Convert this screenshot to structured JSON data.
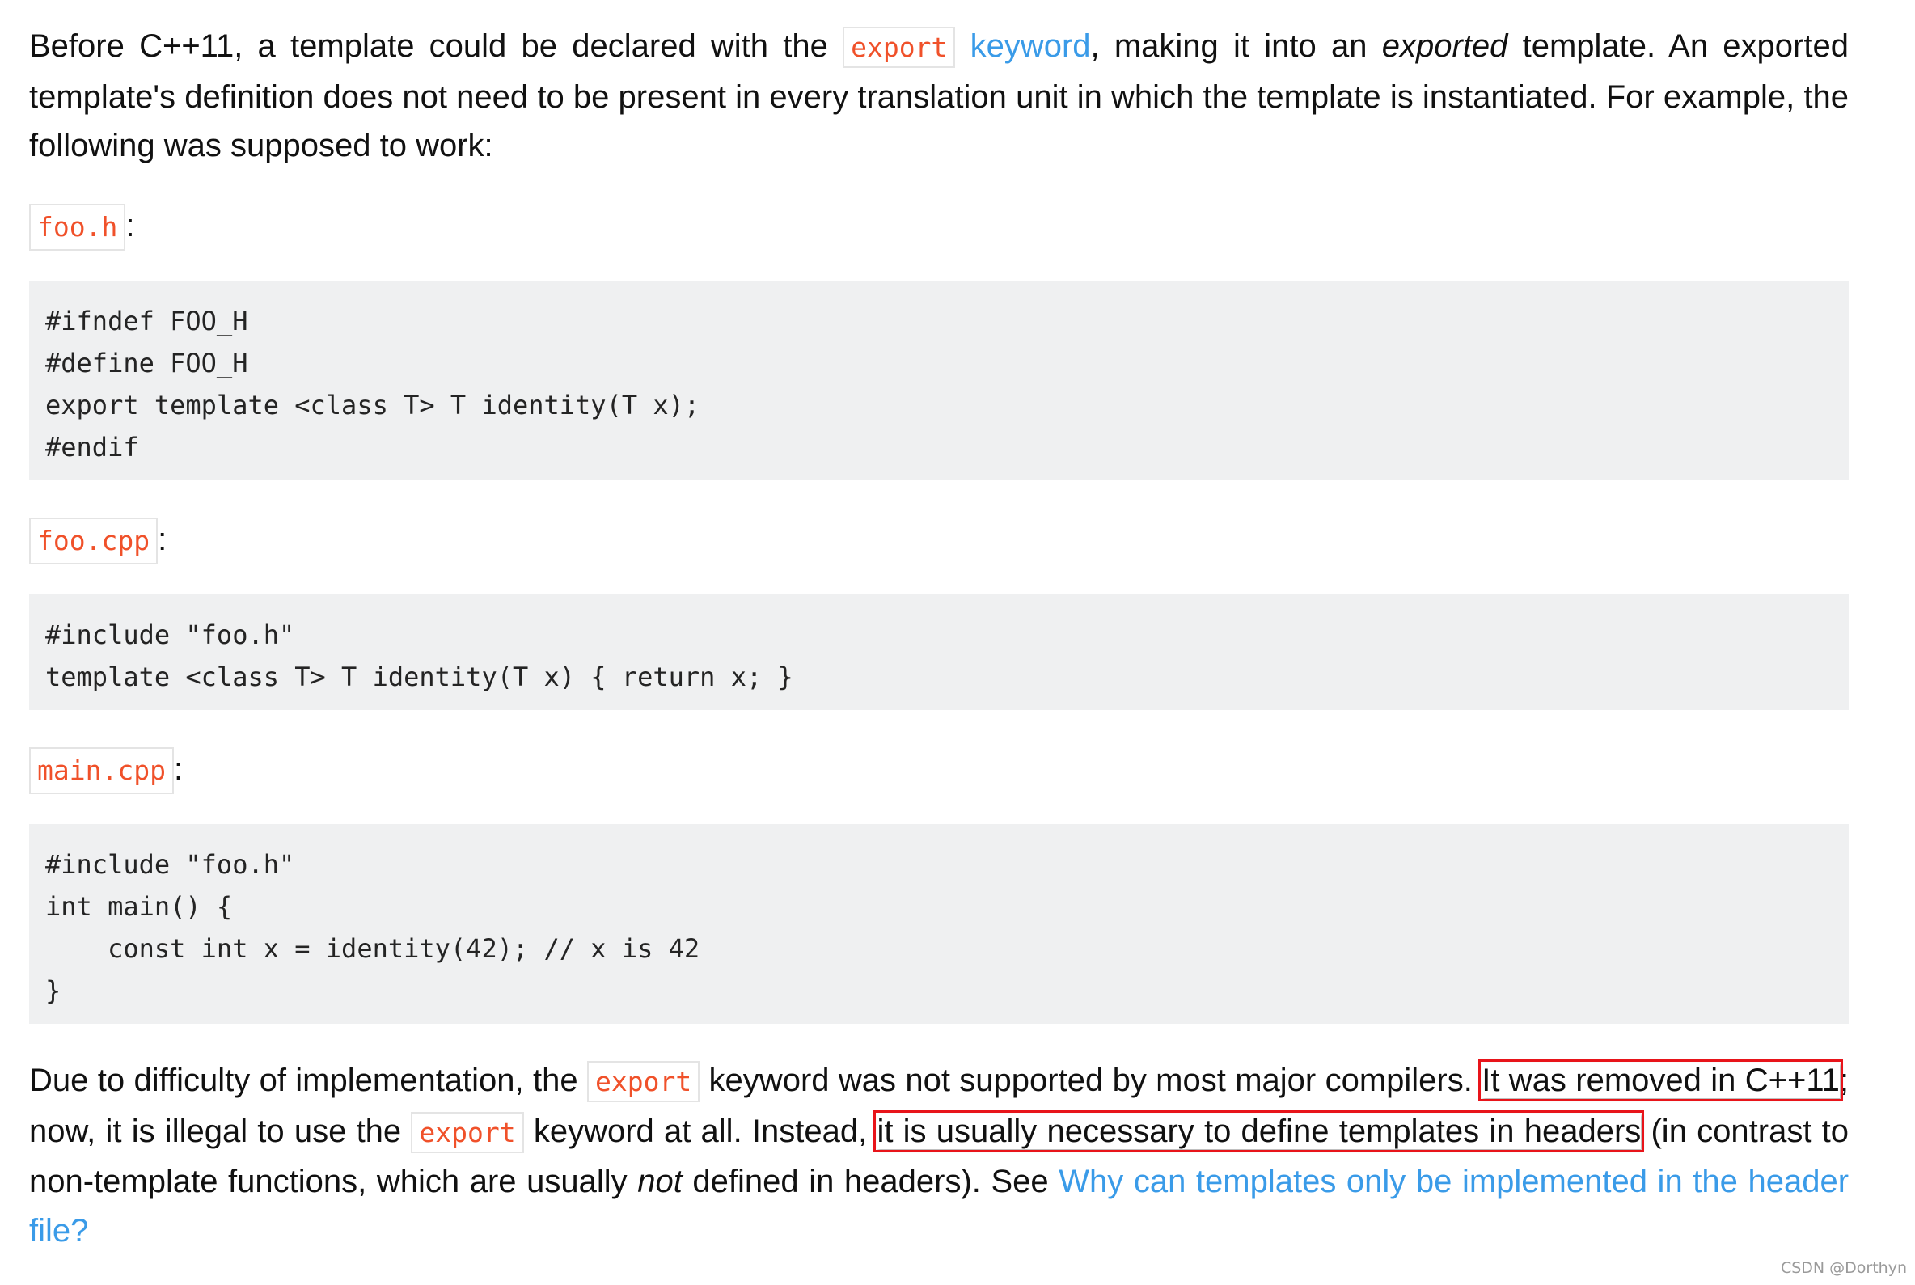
{
  "intro": {
    "t1": "Before C++11, a template could be declared with the ",
    "code": "export",
    "link": "keyword",
    "t2": ", making it into an ",
    "em": "exported",
    "t3": " template. An exported template's definition does not need to be present in every translation unit in which the template is instantiated. For example, the following was supposed to work:"
  },
  "files": [
    {
      "name": "foo.h",
      "code": "#ifndef FOO_H\n#define FOO_H\nexport template <class T> T identity(T x);\n#endif"
    },
    {
      "name": "foo.cpp",
      "code": "#include \"foo.h\"\ntemplate <class T> T identity(T x) { return x; }"
    },
    {
      "name": "main.cpp",
      "code": "#include \"foo.h\"\nint main() {\n    const int x = identity(42); // x is 42\n}"
    }
  ],
  "colon": ":",
  "outro": {
    "t1": "Due to difficulty of implementation, the ",
    "code1": "export",
    "t2": " keyword was not supported by most major compilers. ",
    "hl1": "It was removed in C++11",
    "t3": "; now, it is illegal to use the ",
    "code2": "export",
    "t4": " keyword at all. Instead, ",
    "hl2": "it is usually necessary to define templates in headers",
    "t5": " (in contrast to non-template functions, which are usually ",
    "em": "not",
    "t6": " defined in headers). See ",
    "link": "Why can templates only be implemented in the header file?"
  },
  "watermark": "CSDN @Dorthyn",
  "colors": {
    "link": "#3a9be8",
    "inline_code": "#f0512a",
    "highlight_box": "#e8141a",
    "code_bg": "#eff0f1"
  }
}
